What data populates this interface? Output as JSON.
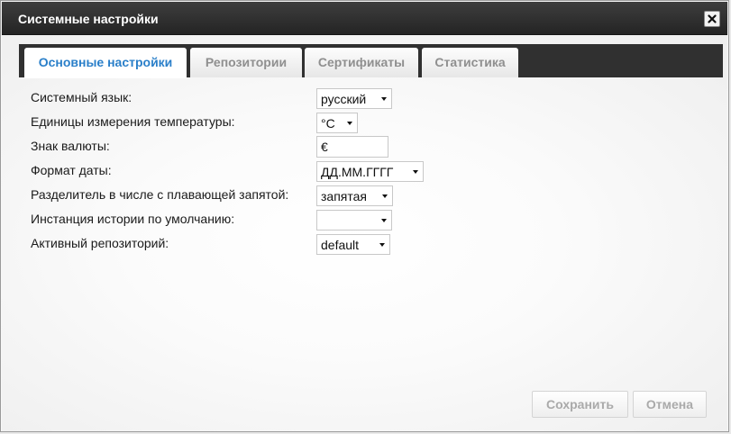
{
  "dialog": {
    "title": "Системные настройки",
    "close_icon": "close-x-icon"
  },
  "tabs": [
    {
      "label": "Основные настройки",
      "active": true
    },
    {
      "label": "Репозитории",
      "active": false
    },
    {
      "label": "Сертификаты",
      "active": false
    },
    {
      "label": "Статистика",
      "active": false
    }
  ],
  "form": {
    "system_language": {
      "label": "Системный язык:",
      "value": "русский"
    },
    "temperature_units": {
      "label": "Единицы измерения температуры:",
      "value": "°C"
    },
    "currency_sign": {
      "label": "Знак валюты:",
      "value": "€"
    },
    "date_format": {
      "label": "Формат даты:",
      "value": "ДД.ММ.ГГГГ"
    },
    "decimal_separator": {
      "label": "Разделитель в числе с плавающей запятой:",
      "value": "запятая"
    },
    "default_history_instance": {
      "label": "Инстанция истории по умолчанию:",
      "value": ""
    },
    "active_repository": {
      "label": "Активный репозиторий:",
      "value": "default"
    }
  },
  "buttons": {
    "save_label": "Сохранить",
    "cancel_label": "Отмена"
  },
  "colors": {
    "titlebar": "#2f2f2f",
    "tabbar": "#303030",
    "active_tab_text": "#2a7fc9",
    "inactive_tab_text": "#8f8f8f",
    "button_text": "#aaaaaa"
  }
}
